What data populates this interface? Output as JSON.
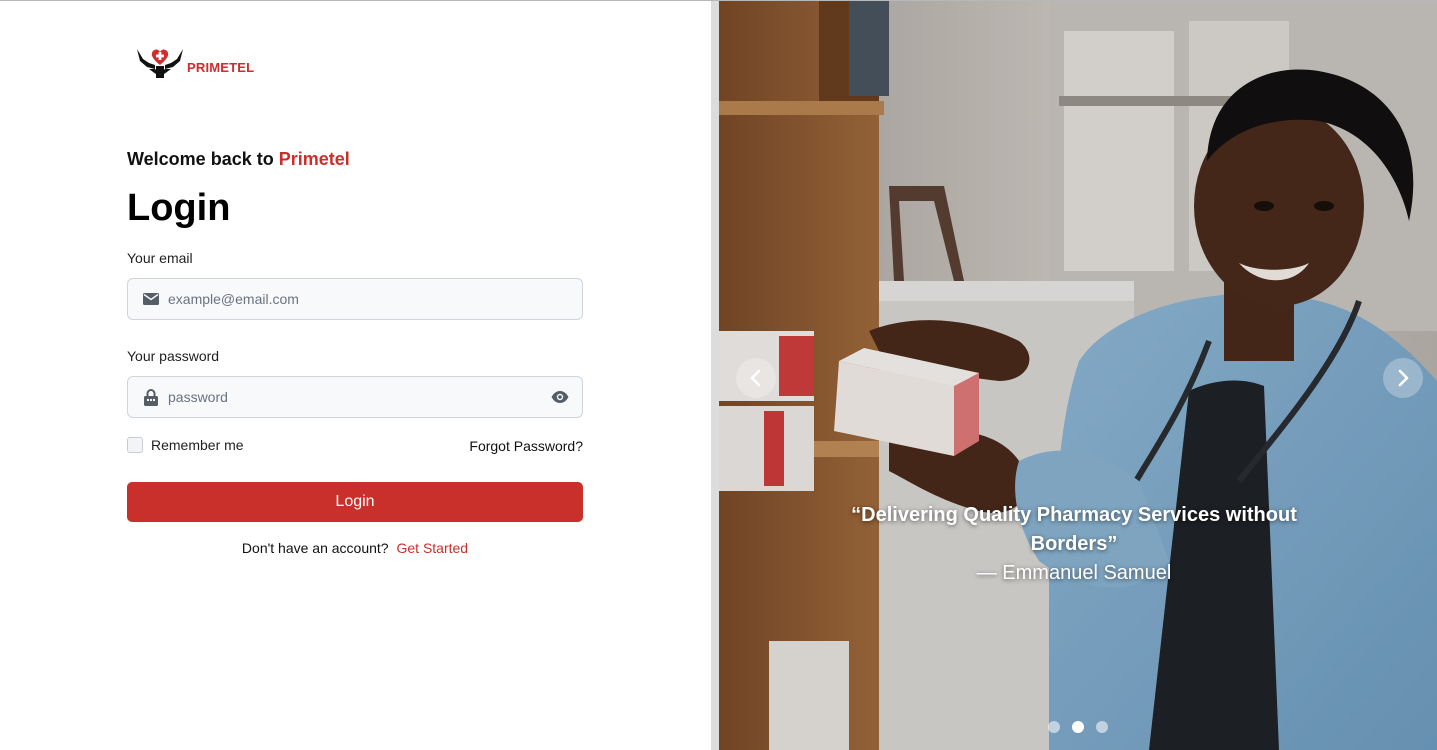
{
  "brand": {
    "logo_text": "PRIMETEL",
    "accent_color": "#c9302c"
  },
  "login_form": {
    "welcome_prefix": "Welcome back to",
    "welcome_brand": "Primetel",
    "title": "Login",
    "email": {
      "label": "Your email",
      "placeholder": "example@email.com",
      "value": "",
      "icon": "envelope-icon"
    },
    "password": {
      "label": "Your password",
      "placeholder": "password",
      "value": "",
      "icon": "lock-icon",
      "toggle_icon": "eye-icon"
    },
    "remember_me_label": "Remember me",
    "remember_me_checked": false,
    "forgot_password_label": "Forgot Password?",
    "submit_label": "Login",
    "signup_prompt": "Don't have an account?",
    "signup_link": "Get Started"
  },
  "carousel": {
    "quote": "“Delivering Quality Pharmacy Services without Borders”",
    "author": "— Emmanuel Samuel",
    "prev_icon": "chevron-left-icon",
    "next_icon": "chevron-right-icon",
    "slide_count": 3,
    "active_slide": 2
  }
}
